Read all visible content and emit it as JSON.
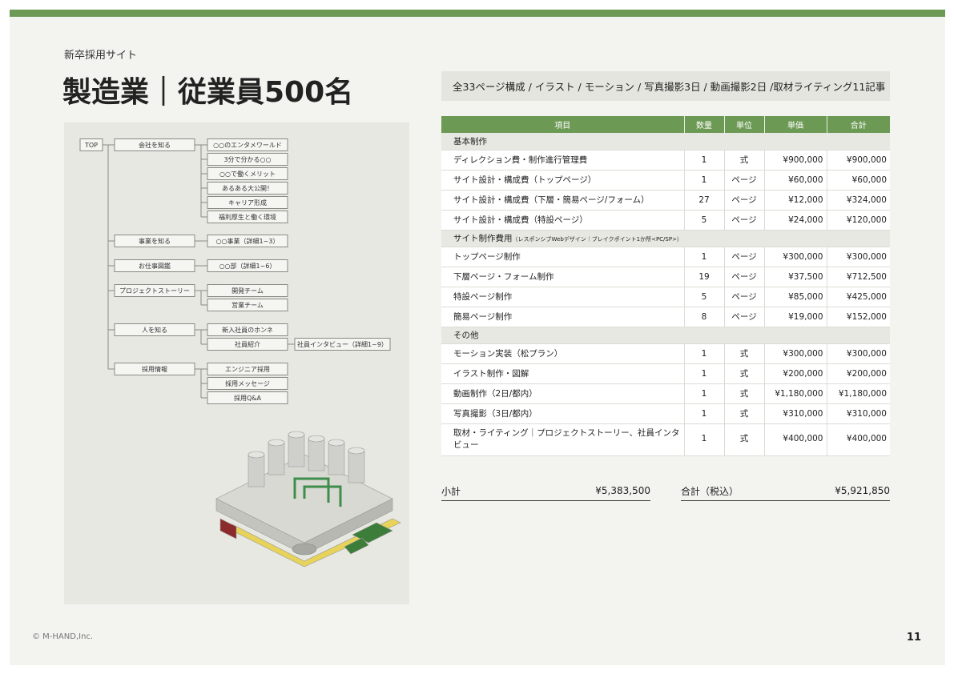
{
  "header": {
    "subtitle": "新卒採用サイト",
    "title": "製造業｜従業員500名",
    "scope": "全33ページ構成 / イラスト / モーション / 写真撮影3日 / 動画撮影2日 /取材ライティング11記事"
  },
  "sitemap": {
    "root": "TOP",
    "categories": [
      {
        "label": "会社を知る",
        "children": [
          "○○のエンタメワールド",
          "3分で分かる○○",
          "○○で働くメリット",
          "あるある大公開！",
          "キャリア形成",
          "福利厚生と働く環境"
        ]
      },
      {
        "label": "事業を知る",
        "children": [
          "○○事業（詳細1~3）"
        ]
      },
      {
        "label": "お仕事図鑑",
        "children": [
          "○○部（詳細1~6）"
        ]
      },
      {
        "label": "プロジェクトストーリー",
        "children": [
          "開発チーム",
          "営業チーム"
        ]
      },
      {
        "label": "人を知る",
        "children": [
          "新入社員のホンネ",
          "社員紹介"
        ],
        "grandchild": "社員インタビュー（詳細1~9）"
      },
      {
        "label": "採用情報",
        "children": [
          "エンジニア採用",
          "採用メッセージ",
          "採用Q&A"
        ]
      }
    ]
  },
  "table": {
    "headers": [
      "項目",
      "数量",
      "単位",
      "単価",
      "合計"
    ],
    "sections": [
      {
        "title": "基本制作",
        "note": "",
        "rows": [
          {
            "item": "ディレクション費・制作進行管理費",
            "qty": "1",
            "unit": "式",
            "price": "¥900,000",
            "total": "¥900,000"
          },
          {
            "item": "サイト設計・構成費（トップページ）",
            "qty": "1",
            "unit": "ページ",
            "price": "¥60,000",
            "total": "¥60,000"
          },
          {
            "item": "サイト設計・構成費（下層・簡易ページ/フォーム）",
            "qty": "27",
            "unit": "ページ",
            "price": "¥12,000",
            "total": "¥324,000"
          },
          {
            "item": "サイト設計・構成費（特設ページ）",
            "qty": "5",
            "unit": "ページ",
            "price": "¥24,000",
            "total": "¥120,000"
          }
        ]
      },
      {
        "title": "サイト制作費用",
        "note": "（レスポンシブWebデザイン｜ブレイクポイント1か所<PC/SP>）",
        "rows": [
          {
            "item": "トップページ制作",
            "qty": "1",
            "unit": "ページ",
            "price": "¥300,000",
            "total": "¥300,000"
          },
          {
            "item": "下層ページ・フォーム制作",
            "qty": "19",
            "unit": "ページ",
            "price": "¥37,500",
            "total": "¥712,500"
          },
          {
            "item": "特設ページ制作",
            "qty": "5",
            "unit": "ページ",
            "price": "¥85,000",
            "total": "¥425,000"
          },
          {
            "item": "簡易ページ制作",
            "qty": "8",
            "unit": "ページ",
            "price": "¥19,000",
            "total": "¥152,000"
          }
        ]
      },
      {
        "title": "その他",
        "note": "",
        "rows": [
          {
            "item": "モーション実装（松プラン）",
            "qty": "1",
            "unit": "式",
            "price": "¥300,000",
            "total": "¥300,000"
          },
          {
            "item": "イラスト制作・図解",
            "qty": "1",
            "unit": "式",
            "price": "¥200,000",
            "total": "¥200,000"
          },
          {
            "item": "動画制作（2日/都内）",
            "qty": "1",
            "unit": "式",
            "price": "¥1,180,000",
            "total": "¥1,180,000"
          },
          {
            "item": "写真撮影（3日/都内）",
            "qty": "1",
            "unit": "式",
            "price": "¥310,000",
            "total": "¥310,000"
          },
          {
            "item": "取材・ライティング｜プロジェクトストーリー、社員インタビュー",
            "qty": "1",
            "unit": "式",
            "price": "¥400,000",
            "total": "¥400,000"
          }
        ]
      }
    ]
  },
  "summary": {
    "subtotal_label": "小計",
    "subtotal_value": "¥5,383,500",
    "total_label": "合計（税込）",
    "total_value": "¥5,921,850"
  },
  "footer": {
    "copyright": "© M-HAND,Inc.",
    "page_number": "11"
  },
  "colors": {
    "accent": "#6c9a55",
    "panel": "#e8e8e3",
    "background": "#f3f3ef"
  }
}
